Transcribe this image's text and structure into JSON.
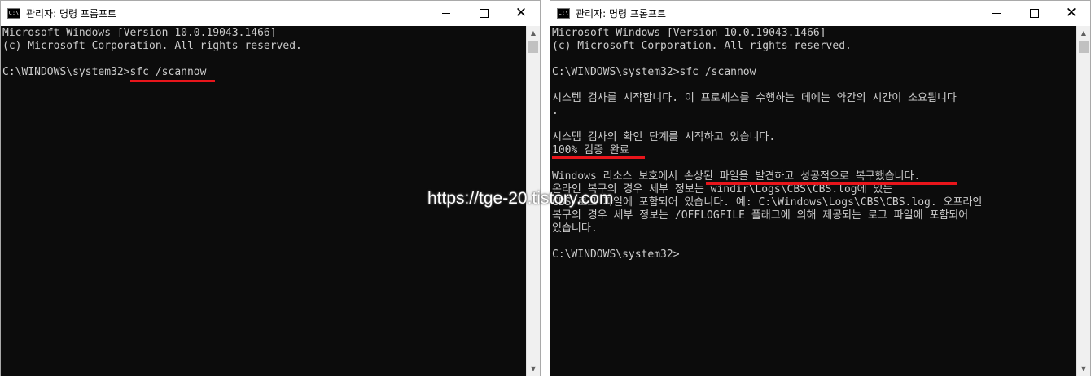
{
  "left_window": {
    "title": "관리자: 명령 프롬프트",
    "lines": [
      "Microsoft Windows [Version 10.0.19043.1466]",
      "(c) Microsoft Corporation. All rights reserved.",
      "",
      "C:\\WINDOWS\\system32>sfc /scannow"
    ]
  },
  "right_window": {
    "title": "관리자: 명령 프롬프트",
    "lines": [
      "Microsoft Windows [Version 10.0.19043.1466]",
      "(c) Microsoft Corporation. All rights reserved.",
      "",
      "C:\\WINDOWS\\system32>sfc /scannow",
      "",
      "시스템 검사를 시작합니다. 이 프로세스를 수행하는 데에는 약간의 시간이 소요됩니다",
      ".",
      "",
      "시스템 검사의 확인 단계를 시작하고 있습니다.",
      "100% 검증 완료",
      "",
      "Windows 리소스 보호에서 손상된 파일을 발견하고 성공적으로 복구했습니다.",
      "온라인 복구의 경우 세부 정보는 windir\\Logs\\CBS\\CBS.log에 있는",
      "CBS 로그 파일에 포함되어 있습니다. 예: C:\\Windows\\Logs\\CBS\\CBS.log. 오프라인",
      "복구의 경우 세부 정보는 /OFFLOGFILE 플래그에 의해 제공되는 로그 파일에 포함되어",
      "있습니다.",
      "",
      "C:\\WINDOWS\\system32>"
    ]
  },
  "watermark": "https://tge-20.tistory.com",
  "icons": {
    "app": "cmd-icon",
    "minimize": "minimize-icon",
    "maximize": "maximize-icon",
    "close": "close-icon"
  },
  "colors": {
    "console_bg": "#0c0c0c",
    "console_text": "#cccccc",
    "highlight_underline": "#e8151b"
  }
}
